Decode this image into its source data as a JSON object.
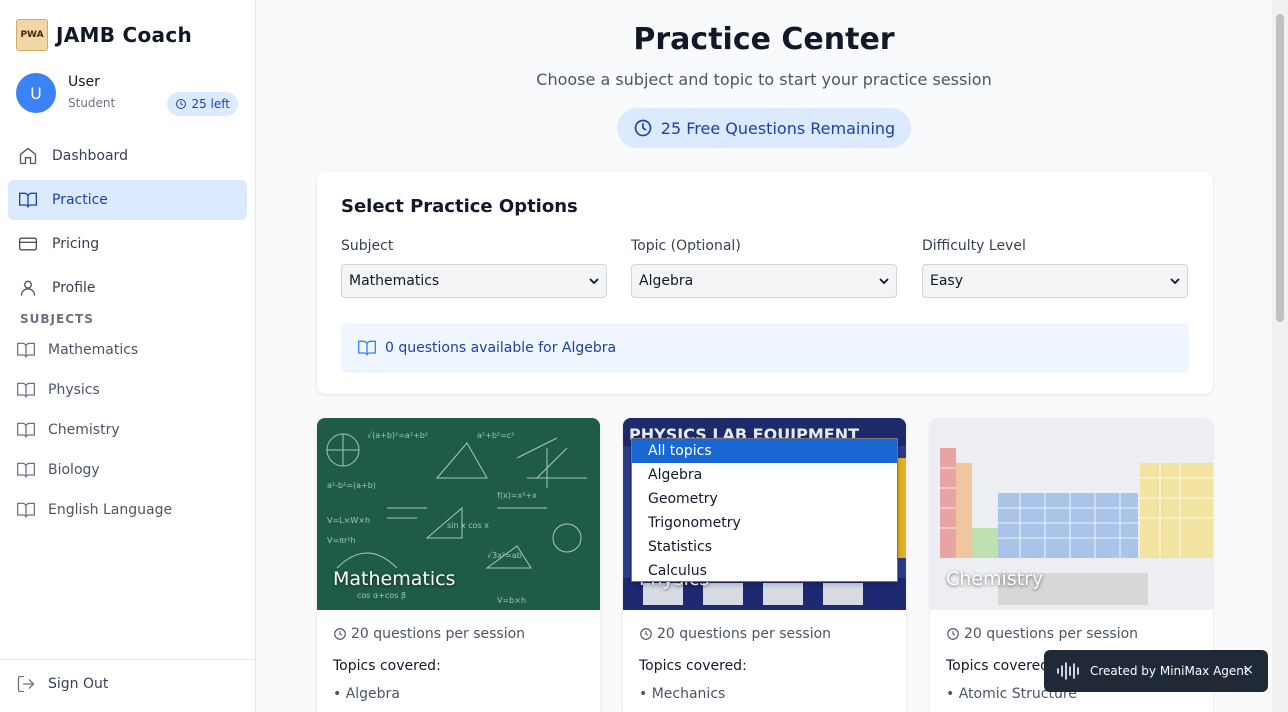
{
  "app": {
    "name": "JAMB Coach",
    "logo_text": "PWA"
  },
  "user": {
    "initial": "U",
    "name": "User",
    "role": "Student",
    "credits": "25 left"
  },
  "nav": [
    {
      "label": "Dashboard",
      "icon": "home-icon"
    },
    {
      "label": "Practice",
      "icon": "book-open-icon",
      "active": true
    },
    {
      "label": "Pricing",
      "icon": "credit-card-icon"
    },
    {
      "label": "Profile",
      "icon": "user-icon"
    }
  ],
  "subjects_heading": "SUBJECTS",
  "subjects": [
    "Mathematics",
    "Physics",
    "Chemistry",
    "Biology",
    "English Language"
  ],
  "signout_label": "Sign Out",
  "page": {
    "title": "Practice Center",
    "subtitle": "Choose a subject and topic to start your practice session",
    "remaining": "25 Free Questions Remaining"
  },
  "options": {
    "title": "Select Practice Options",
    "subject_label": "Subject",
    "subject_value": "Mathematics",
    "topic_label": "Topic (Optional)",
    "topic_value": "Algebra",
    "difficulty_label": "Difficulty Level",
    "difficulty_value": "Easy",
    "info": "0 questions available for Algebra"
  },
  "topic_dropdown": [
    "All topics",
    "Algebra",
    "Geometry",
    "Trigonometry",
    "Statistics",
    "Calculus"
  ],
  "cards": [
    {
      "title": "Mathematics",
      "meta": "20 questions per session",
      "topics_label": "Topics covered:",
      "first_topic": "• Algebra"
    },
    {
      "title": "Physics",
      "meta": "20 questions per session",
      "topics_label": "Topics covered:",
      "first_topic": "• Mechanics"
    },
    {
      "title": "Chemistry",
      "meta": "20 questions per session",
      "topics_label": "Topics covered:",
      "first_topic": "• Atomic Structure"
    }
  ],
  "toast": {
    "text": "Created by MiniMax Agent",
    "close": "×"
  },
  "colors": {
    "accent": "#3b82f6",
    "accent_light": "#dbeafe",
    "accent_dark": "#1e40af",
    "chalkboard": "#1f5c48"
  }
}
